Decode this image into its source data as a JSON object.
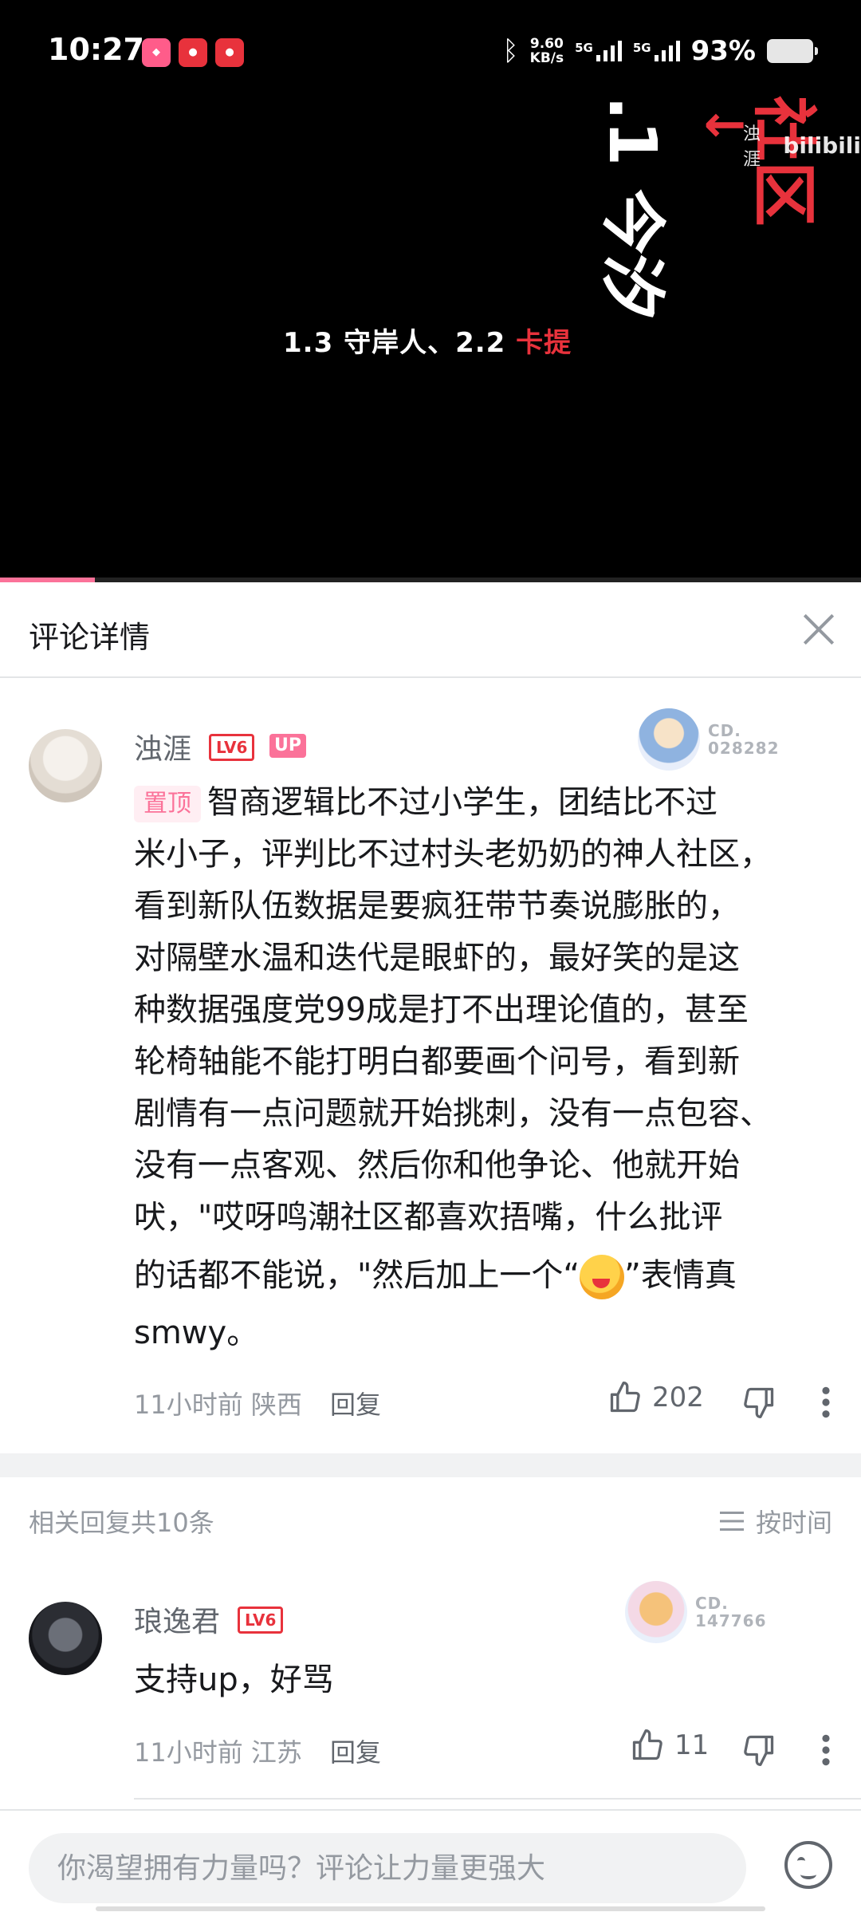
{
  "status_bar": {
    "time": "10:27",
    "net_speed_value": "9.60",
    "net_speed_unit": "KB/s",
    "sim1": "5G",
    "sim2": "5G",
    "battery": "93%"
  },
  "video": {
    "overlay_text_prefix": "1.3 守岸人、2.2 ",
    "overlay_text_highlight": "卡提",
    "vertical_text_white": ".1 今汐",
    "vertical_text_red": "社区",
    "watermark_user": "浊涯",
    "watermark_brand": "bilibili",
    "progress_percent": 11
  },
  "panel": {
    "title": "评论详情"
  },
  "main_comment": {
    "username": "浊涯",
    "level": "LV6",
    "up_badge": "UP",
    "fan_badge_label": "CD.",
    "fan_badge_number": "028282",
    "pinned_tag": "置顶",
    "lines": [
      "智商逻辑比不过小学生，团结比不过",
      "米小子，评判比不过村头老奶奶的神人社区，",
      "看到新队伍数据是要疯狂带节奏说膨胀的，",
      "对隔壁水温和迭代是眼虾的，最好笑的是这",
      "种数据强度党99成是打不出理论值的，甚至",
      "轮椅轴能不能打明白都要画个问号，看到新",
      "剧情有一点问题就开始挑刺，没有一点包容、",
      "没有一点客观、然后你和他争论、他就开始",
      "吠，\"哎呀鸣潮社区都喜欢捂嘴，什么批评"
    ],
    "line10_before": "的话都不能说，\"然后加上一个“",
    "line10_after": "”表情真",
    "line11": "smwy。",
    "time_ago": "11小时前",
    "location": "陕西",
    "reply_label": "回复",
    "likes": "202"
  },
  "replies_section": {
    "count_text": "相关回复共10条",
    "sort_label": "按时间"
  },
  "reply_comment": {
    "username": "琅逸君",
    "level": "LV6",
    "fan_badge_label": "CD.",
    "fan_badge_number": "147766",
    "text": "支持up，好骂",
    "time_ago": "11小时前",
    "location": "江苏",
    "reply_label": "回复",
    "likes": "11"
  },
  "input": {
    "placeholder": "你渴望拥有力量吗？评论让力量更强大"
  },
  "colors": {
    "brand_pink": "#fb7299",
    "level_red": "#e8323c",
    "text_primary": "#18191c",
    "text_secondary": "#61666d",
    "text_muted": "#9499a0"
  }
}
